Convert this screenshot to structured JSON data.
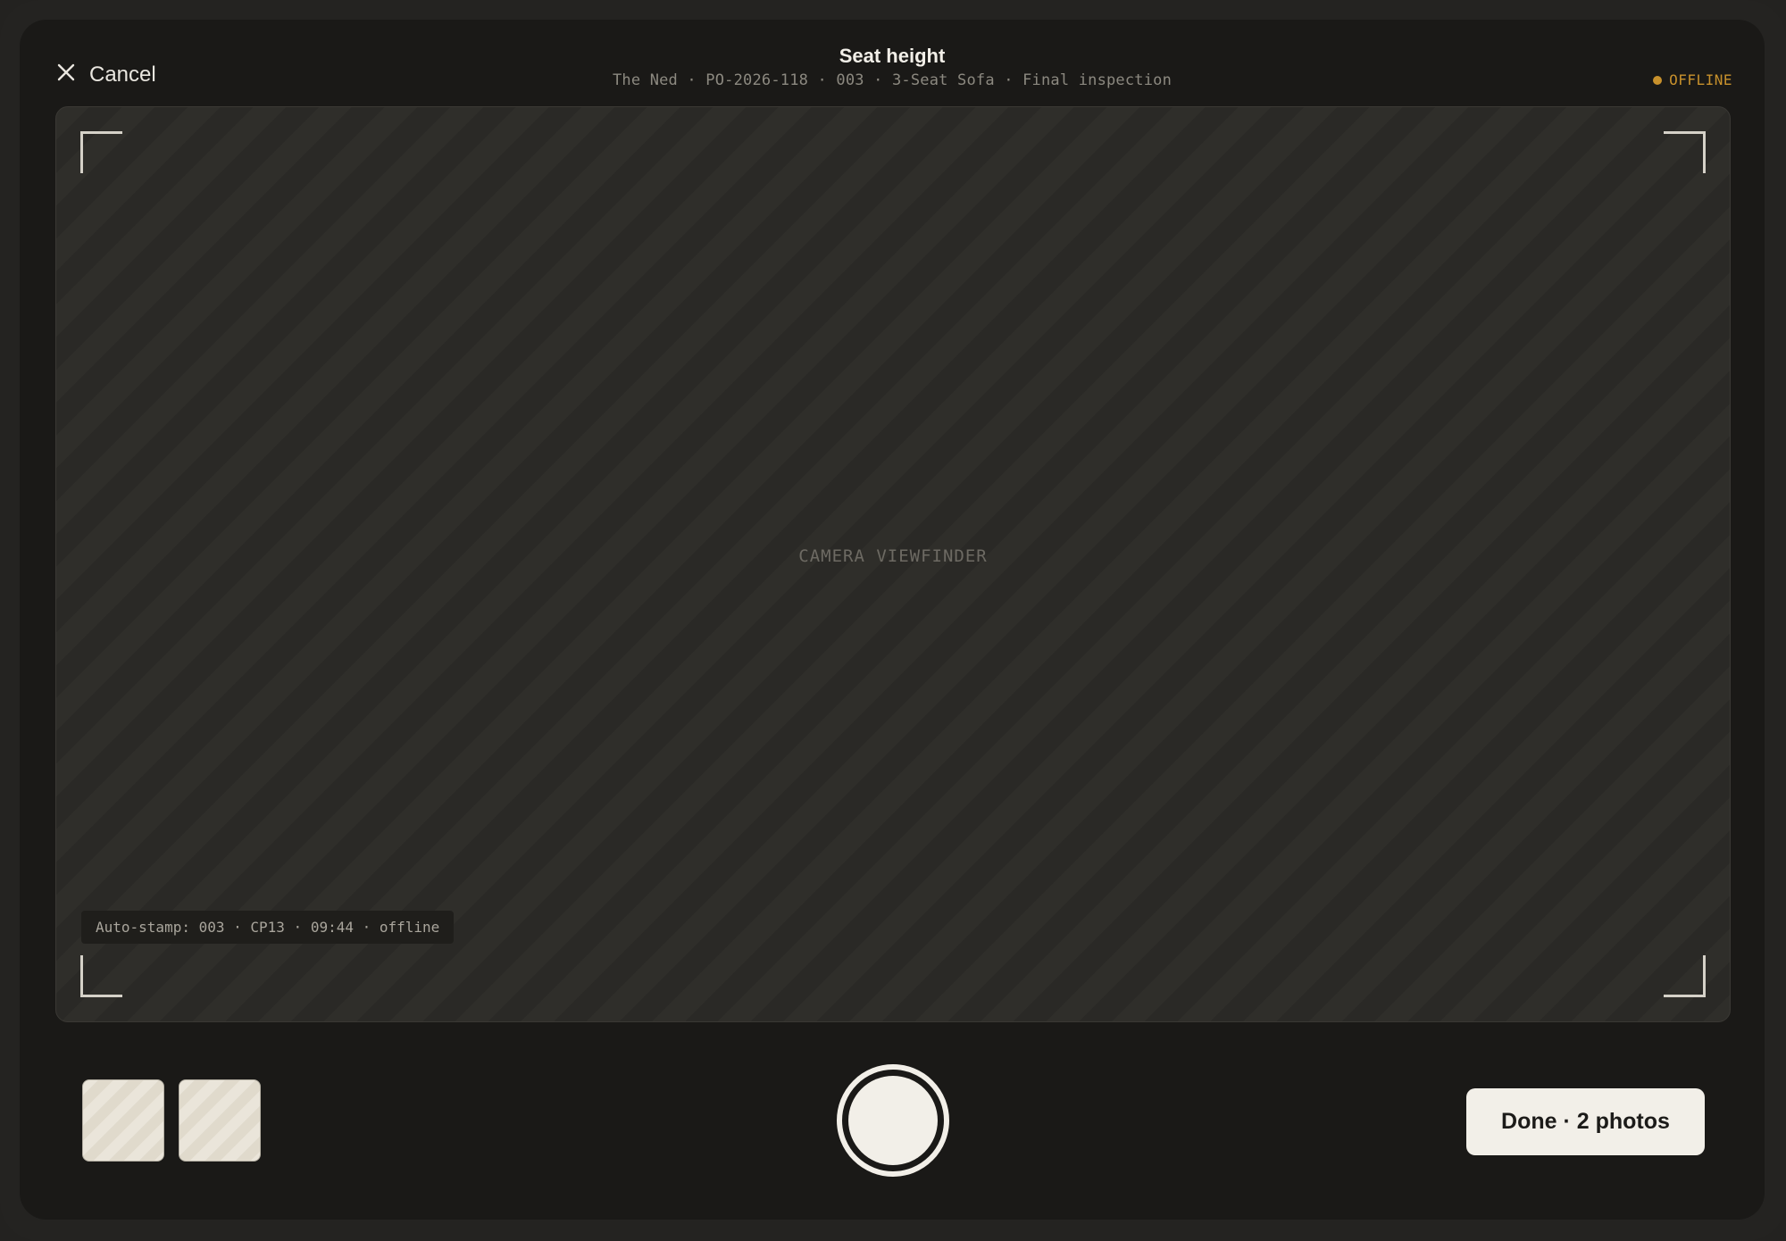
{
  "header": {
    "cancel_label": "Cancel",
    "cancel_icon": "close-icon",
    "title": "Seat height",
    "subtitle": "The Ned · PO-2026-118 · 003 · 3-Seat Sofa · Final inspection",
    "status_label": "OFFLINE",
    "status_color": "#c8912c"
  },
  "viewfinder": {
    "label": "CAMERA VIEWFINDER",
    "stamp": "Auto-stamp: 003 · CP13 · 09:44 · offline"
  },
  "capture": {
    "thumbnail_count": 2,
    "done_label": "Done · 2 photos"
  },
  "colors": {
    "background": "#1a1917",
    "accent_light": "#f2efe8",
    "offline": "#c8912c"
  }
}
